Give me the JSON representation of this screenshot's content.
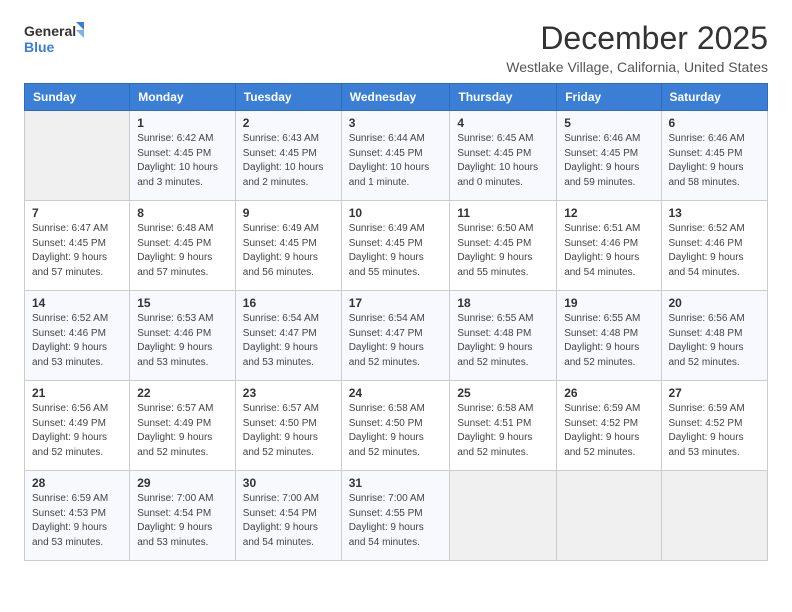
{
  "header": {
    "logo_general": "General",
    "logo_blue": "Blue",
    "month_title": "December 2025",
    "location": "Westlake Village, California, United States"
  },
  "weekdays": [
    "Sunday",
    "Monday",
    "Tuesday",
    "Wednesday",
    "Thursday",
    "Friday",
    "Saturday"
  ],
  "weeks": [
    [
      {
        "day": "",
        "info": ""
      },
      {
        "day": "1",
        "info": "Sunrise: 6:42 AM\nSunset: 4:45 PM\nDaylight: 10 hours\nand 3 minutes."
      },
      {
        "day": "2",
        "info": "Sunrise: 6:43 AM\nSunset: 4:45 PM\nDaylight: 10 hours\nand 2 minutes."
      },
      {
        "day": "3",
        "info": "Sunrise: 6:44 AM\nSunset: 4:45 PM\nDaylight: 10 hours\nand 1 minute."
      },
      {
        "day": "4",
        "info": "Sunrise: 6:45 AM\nSunset: 4:45 PM\nDaylight: 10 hours\nand 0 minutes."
      },
      {
        "day": "5",
        "info": "Sunrise: 6:46 AM\nSunset: 4:45 PM\nDaylight: 9 hours\nand 59 minutes."
      },
      {
        "day": "6",
        "info": "Sunrise: 6:46 AM\nSunset: 4:45 PM\nDaylight: 9 hours\nand 58 minutes."
      }
    ],
    [
      {
        "day": "7",
        "info": "Sunrise: 6:47 AM\nSunset: 4:45 PM\nDaylight: 9 hours\nand 57 minutes."
      },
      {
        "day": "8",
        "info": "Sunrise: 6:48 AM\nSunset: 4:45 PM\nDaylight: 9 hours\nand 57 minutes."
      },
      {
        "day": "9",
        "info": "Sunrise: 6:49 AM\nSunset: 4:45 PM\nDaylight: 9 hours\nand 56 minutes."
      },
      {
        "day": "10",
        "info": "Sunrise: 6:49 AM\nSunset: 4:45 PM\nDaylight: 9 hours\nand 55 minutes."
      },
      {
        "day": "11",
        "info": "Sunrise: 6:50 AM\nSunset: 4:45 PM\nDaylight: 9 hours\nand 55 minutes."
      },
      {
        "day": "12",
        "info": "Sunrise: 6:51 AM\nSunset: 4:46 PM\nDaylight: 9 hours\nand 54 minutes."
      },
      {
        "day": "13",
        "info": "Sunrise: 6:52 AM\nSunset: 4:46 PM\nDaylight: 9 hours\nand 54 minutes."
      }
    ],
    [
      {
        "day": "14",
        "info": "Sunrise: 6:52 AM\nSunset: 4:46 PM\nDaylight: 9 hours\nand 53 minutes."
      },
      {
        "day": "15",
        "info": "Sunrise: 6:53 AM\nSunset: 4:46 PM\nDaylight: 9 hours\nand 53 minutes."
      },
      {
        "day": "16",
        "info": "Sunrise: 6:54 AM\nSunset: 4:47 PM\nDaylight: 9 hours\nand 53 minutes."
      },
      {
        "day": "17",
        "info": "Sunrise: 6:54 AM\nSunset: 4:47 PM\nDaylight: 9 hours\nand 52 minutes."
      },
      {
        "day": "18",
        "info": "Sunrise: 6:55 AM\nSunset: 4:48 PM\nDaylight: 9 hours\nand 52 minutes."
      },
      {
        "day": "19",
        "info": "Sunrise: 6:55 AM\nSunset: 4:48 PM\nDaylight: 9 hours\nand 52 minutes."
      },
      {
        "day": "20",
        "info": "Sunrise: 6:56 AM\nSunset: 4:48 PM\nDaylight: 9 hours\nand 52 minutes."
      }
    ],
    [
      {
        "day": "21",
        "info": "Sunrise: 6:56 AM\nSunset: 4:49 PM\nDaylight: 9 hours\nand 52 minutes."
      },
      {
        "day": "22",
        "info": "Sunrise: 6:57 AM\nSunset: 4:49 PM\nDaylight: 9 hours\nand 52 minutes."
      },
      {
        "day": "23",
        "info": "Sunrise: 6:57 AM\nSunset: 4:50 PM\nDaylight: 9 hours\nand 52 minutes."
      },
      {
        "day": "24",
        "info": "Sunrise: 6:58 AM\nSunset: 4:50 PM\nDaylight: 9 hours\nand 52 minutes."
      },
      {
        "day": "25",
        "info": "Sunrise: 6:58 AM\nSunset: 4:51 PM\nDaylight: 9 hours\nand 52 minutes."
      },
      {
        "day": "26",
        "info": "Sunrise: 6:59 AM\nSunset: 4:52 PM\nDaylight: 9 hours\nand 52 minutes."
      },
      {
        "day": "27",
        "info": "Sunrise: 6:59 AM\nSunset: 4:52 PM\nDaylight: 9 hours\nand 53 minutes."
      }
    ],
    [
      {
        "day": "28",
        "info": "Sunrise: 6:59 AM\nSunset: 4:53 PM\nDaylight: 9 hours\nand 53 minutes."
      },
      {
        "day": "29",
        "info": "Sunrise: 7:00 AM\nSunset: 4:54 PM\nDaylight: 9 hours\nand 53 minutes."
      },
      {
        "day": "30",
        "info": "Sunrise: 7:00 AM\nSunset: 4:54 PM\nDaylight: 9 hours\nand 54 minutes."
      },
      {
        "day": "31",
        "info": "Sunrise: 7:00 AM\nSunset: 4:55 PM\nDaylight: 9 hours\nand 54 minutes."
      },
      {
        "day": "",
        "info": ""
      },
      {
        "day": "",
        "info": ""
      },
      {
        "day": "",
        "info": ""
      }
    ]
  ]
}
